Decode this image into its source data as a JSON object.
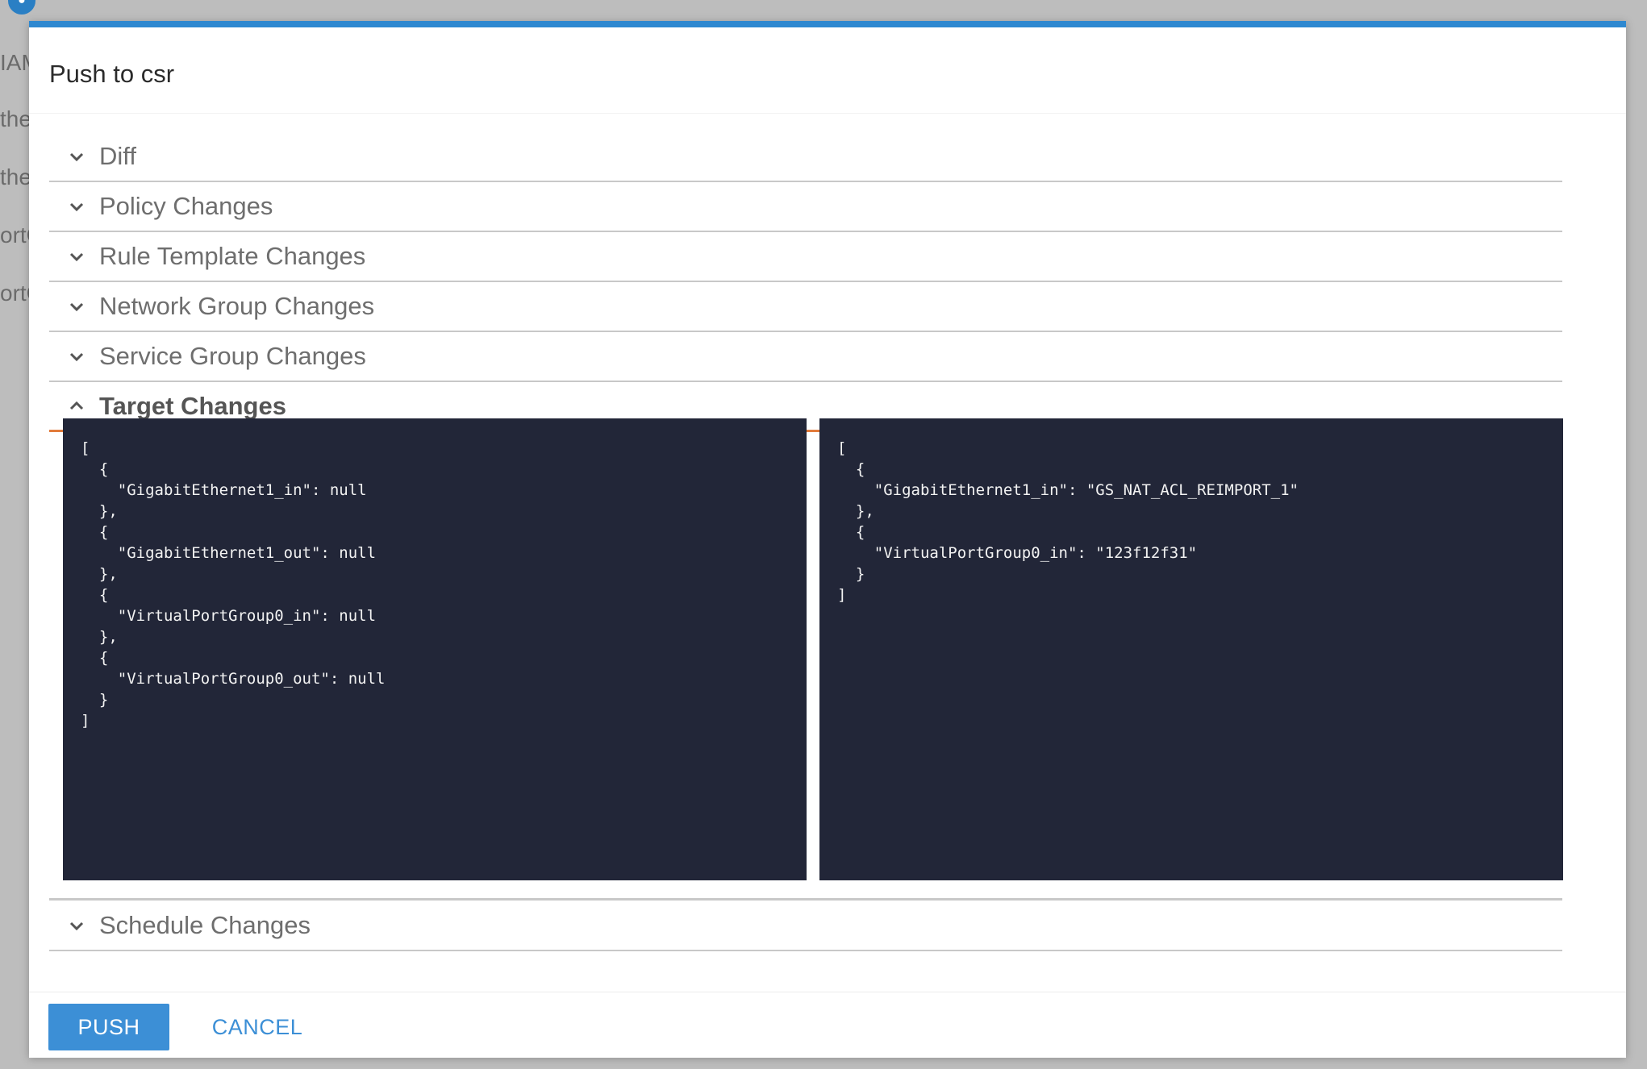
{
  "background": {
    "fragments": [
      "IAM",
      "the",
      "the",
      "ortG",
      "ortG"
    ]
  },
  "modal": {
    "title": "Push to csr",
    "sections": [
      {
        "label": "Diff",
        "expanded": false
      },
      {
        "label": "Policy Changes",
        "expanded": false
      },
      {
        "label": "Rule Template Changes",
        "expanded": false
      },
      {
        "label": "Network Group Changes",
        "expanded": false
      },
      {
        "label": "Service Group Changes",
        "expanded": false
      },
      {
        "label": "Target Changes",
        "expanded": true
      },
      {
        "label": "Schedule Changes",
        "expanded": false
      }
    ],
    "target_changes": {
      "before": "[\n  {\n    \"GigabitEthernet1_in\": null\n  },\n  {\n    \"GigabitEthernet1_out\": null\n  },\n  {\n    \"VirtualPortGroup0_in\": null\n  },\n  {\n    \"VirtualPortGroup0_out\": null\n  }\n]",
      "after": "[\n  {\n    \"GigabitEthernet1_in\": \"GS_NAT_ACL_REIMPORT_1\"\n  },\n  {\n    \"VirtualPortGroup0_in\": \"123f12f31\"\n  }\n]"
    },
    "footer": {
      "push_label": "PUSH",
      "cancel_label": "CANCEL"
    }
  },
  "colors": {
    "accent": "#2e88d0",
    "active_section": "#e27b3b",
    "code_bg": "#222638",
    "button": "#3c8fd6"
  }
}
